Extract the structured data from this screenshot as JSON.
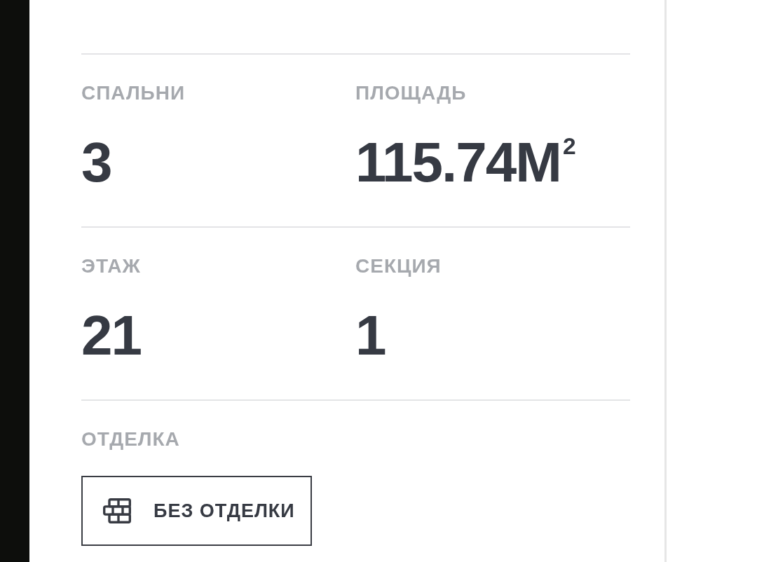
{
  "specs": [
    {
      "label": "СПАЛЬНИ",
      "value": "3"
    },
    {
      "label": "ПЛОЩАДЬ",
      "value": "115.74М$^{2}$"
    },
    {
      "label": "ЭТАЖ",
      "value": "21"
    },
    {
      "label": "СЕКЦИЯ",
      "value": "1"
    }
  ],
  "finish": {
    "label": "ОТДЕЛКА",
    "option": "БЕЗ ОТДЕЛКИ"
  }
}
